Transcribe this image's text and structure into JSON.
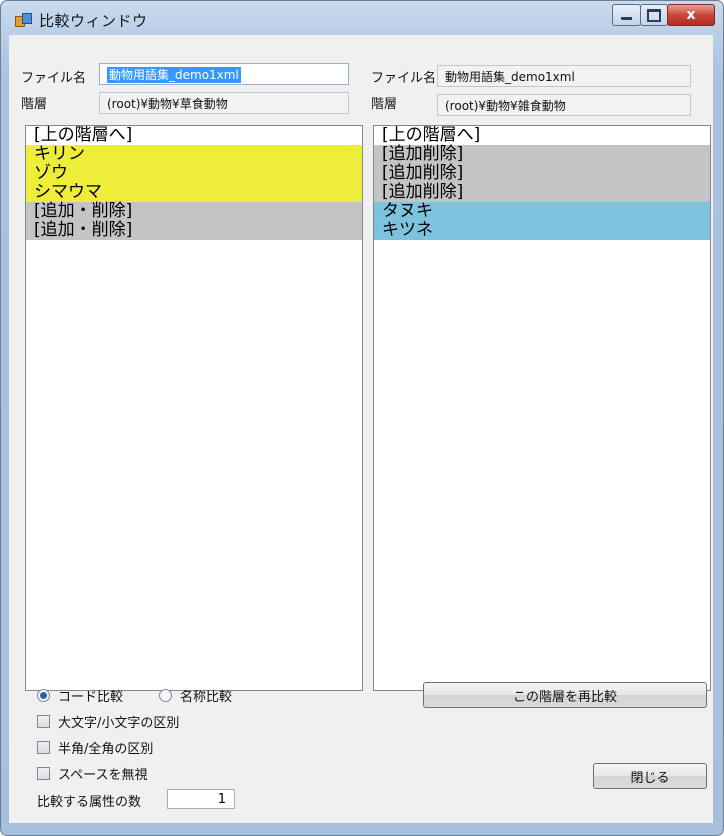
{
  "window": {
    "title": "比較ウィンドウ",
    "close_glyph": "x",
    "icon": "app-icon"
  },
  "left": {
    "file_label": "ファイル名",
    "file_value": "動物用語集_demo1xml",
    "level_label": "階層",
    "level_value": "(root)¥動物¥草食動物",
    "items": [
      {
        "text": "[上の階層へ]",
        "highlight": "none"
      },
      {
        "text": "キリン",
        "highlight": "yellow"
      },
      {
        "text": "ゾウ",
        "highlight": "yellow"
      },
      {
        "text": "シマウマ",
        "highlight": "yellow"
      },
      {
        "text": "[追加・削除]",
        "highlight": "gray"
      },
      {
        "text": "[追加・削除]",
        "highlight": "gray"
      }
    ]
  },
  "right": {
    "file_label": "ファイル名",
    "file_value": "動物用語集_demo1xml",
    "level_label": "階層",
    "level_value": "(root)¥動物¥雑食動物",
    "items": [
      {
        "text": "[上の階層へ]",
        "highlight": "none"
      },
      {
        "text": "[追加削除]",
        "highlight": "gray"
      },
      {
        "text": "[追加削除]",
        "highlight": "gray"
      },
      {
        "text": "[追加削除]",
        "highlight": "gray"
      },
      {
        "text": "タヌキ",
        "highlight": "blue"
      },
      {
        "text": "キツネ",
        "highlight": "blue"
      }
    ]
  },
  "options": {
    "code_compare": "コード比較",
    "name_compare": "名称比較",
    "selected_mode": "code",
    "case_sensitive": "大文字/小文字の区別",
    "width_sensitive": "半角/全角の区別",
    "ignore_space": "スペースを無視",
    "attr_count_label": "比較する属性の数",
    "attr_count_value": "1"
  },
  "buttons": {
    "recompare": "この階層を再比較",
    "close": "閉じる"
  },
  "colors": {
    "yellow": "#eded3a",
    "gray": "#c4c4c4",
    "blue": "#7ec3dd",
    "selection": "#3399ff"
  }
}
